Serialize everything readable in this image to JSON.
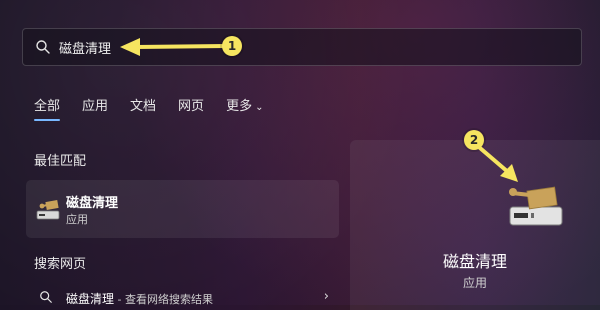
{
  "search": {
    "query": "磁盘清理",
    "annotation_number": "1"
  },
  "tabs": [
    {
      "label": "全部"
    },
    {
      "label": "应用"
    },
    {
      "label": "文档"
    },
    {
      "label": "网页"
    },
    {
      "label": "更多"
    }
  ],
  "best_match": {
    "section_label": "最佳匹配",
    "title": "磁盘清理",
    "subtitle": "应用"
  },
  "web": {
    "section_label": "搜索网页",
    "query": "磁盘清理",
    "suffix": " - 查看网络搜索结果"
  },
  "preview": {
    "title": "磁盘清理",
    "subtitle": "应用",
    "annotation_number": "2"
  },
  "colors": {
    "accent": "#79b8ff",
    "annotation": "#f6e560"
  },
  "icons": {
    "search": "search-icon",
    "app": "disk-cleanup-icon",
    "web": "web-search-icon",
    "more": "chevron-down-icon",
    "open": "chevron-right-icon"
  }
}
